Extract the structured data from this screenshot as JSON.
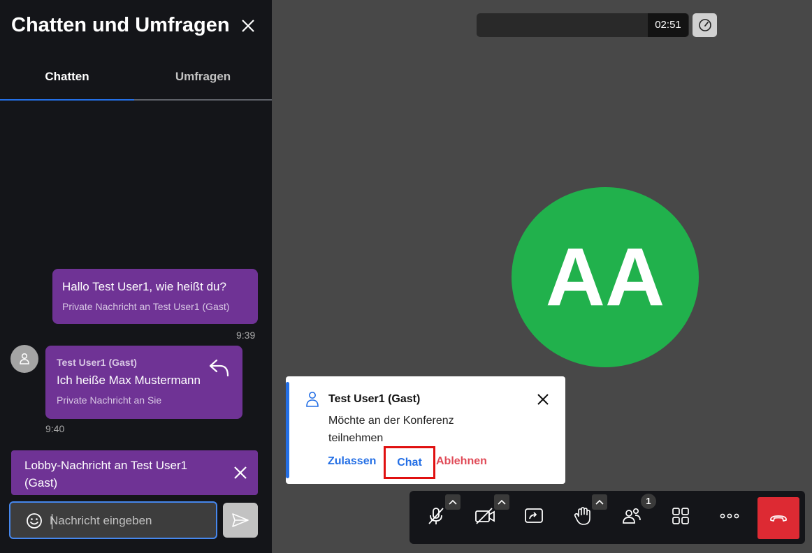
{
  "sidebar": {
    "title": "Chatten und Umfragen",
    "tabs": [
      {
        "label": "Chatten"
      },
      {
        "label": "Umfragen"
      }
    ],
    "messages": {
      "outgoing": {
        "text": "Hallo Test User1, wie heißt du?",
        "sub": "Private Nachricht an Test User1 (Gast)",
        "time": "9:39"
      },
      "incoming": {
        "sender": "Test User1 (Gast)",
        "text": "Ich heiße Max Mustermann",
        "sub": "Private Nachricht an Sie",
        "time": "9:40"
      }
    },
    "lobby_banner": "Lobby-Nachricht an Test User1 (Gast)",
    "input": {
      "placeholder": "Nachricht eingeben"
    }
  },
  "timer": "02:51",
  "participant_initials": "AA",
  "notification": {
    "name": "Test User1 (Gast)",
    "message": "Möchte an der Konferenz teilnehmen",
    "admit_label": "Zulassen",
    "chat_label": "Chat",
    "reject_label": "Ablehnen"
  },
  "toolbar": {
    "participants_badge": "1",
    "icons": [
      "microphone-muted-icon",
      "camera-off-icon",
      "screen-share-icon",
      "raise-hand-icon",
      "participants-icon",
      "tile-view-icon",
      "more-icon",
      "hangup-icon"
    ]
  },
  "colors": {
    "sidebar_bg": "#141519",
    "message_bg": "#6f3395",
    "accent_blue": "#246fe5",
    "avatar_green": "#21b14c",
    "hangup_red": "#dd2a33",
    "reject_red": "#e04a57"
  }
}
